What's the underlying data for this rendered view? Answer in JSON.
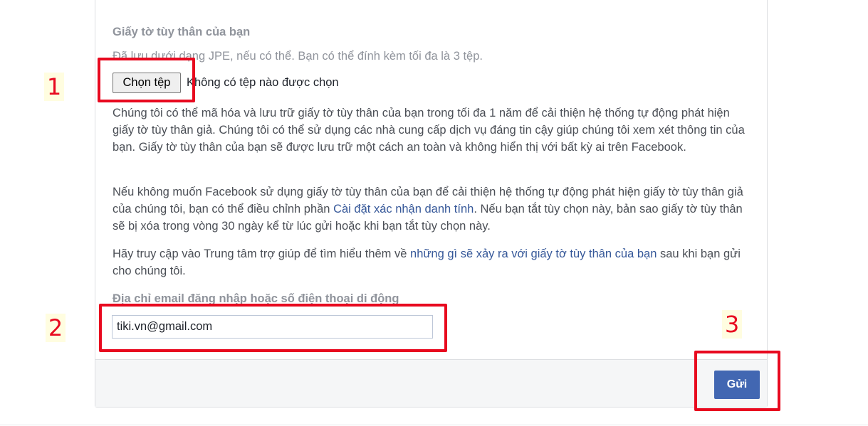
{
  "form": {
    "id_section_label": "Giấy tờ tùy thân của bạn",
    "id_hint": "Đã lưu dưới dạng JPE, nếu có thể. Bạn có thể đính kèm tối đa là 3 tệp.",
    "choose_file_label": "Chọn tệp",
    "no_file_text": "Không có tệp nào được chọn",
    "paragraph1": "Chúng tôi có thể mã hóa và lưu trữ giấy tờ tùy thân của bạn trong tối đa 1 năm để cải thiện hệ thống tự động phát hiện giấy tờ tùy thân giả. Chúng tôi có thể sử dụng các nhà cung cấp dịch vụ đáng tin cậy giúp chúng tôi xem xét thông tin của bạn. Giấy tờ tùy thân của bạn sẽ được lưu trữ một cách an toàn và không hiển thị với bất kỳ ai trên Facebook.",
    "paragraph2": {
      "before": "Nếu không muốn Facebook sử dụng giấy tờ tùy thân của bạn để cải thiện hệ thống tự động phát hiện giấy tờ tùy thân giả của chúng tôi, bạn có thể điều chỉnh phần ",
      "link": "Cài đặt xác nhận danh tính",
      "after": ". Nếu bạn tắt tùy chọn này, bản sao giấy tờ tùy thân sẽ bị xóa trong vòng 30 ngày kể từ lúc gửi hoặc khi bạn tắt tùy chọn này."
    },
    "paragraph3": {
      "before": "Hãy truy cập vào Trung tâm trợ giúp để tìm hiểu thêm về ",
      "link": "những gì sẽ xảy ra với giấy tờ tùy thân của bạn",
      "after": " sau khi bạn gửi cho chúng tôi."
    },
    "email_section_label": "Địa chỉ email đăng nhập hoặc số điện thoại di động",
    "email_value": "tiki.vn@gmail.com",
    "submit_label": "Gửi"
  },
  "annotations": {
    "marker1": "1",
    "marker2": "2",
    "marker3": "3",
    "highlight_color": "#e8091f"
  },
  "colors": {
    "accent": "#4267b2",
    "link": "#365899",
    "muted_text": "#90949c"
  }
}
